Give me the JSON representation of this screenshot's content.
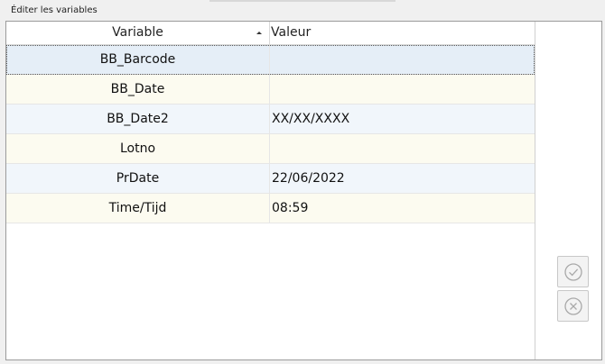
{
  "window": {
    "title": "Éditer les variables"
  },
  "grid": {
    "columns": {
      "variable": "Variable",
      "value": "Valeur"
    },
    "sort": "ascending",
    "rows": [
      {
        "variable": "BB_Barcode",
        "value": "",
        "selected": true
      },
      {
        "variable": "BB_Date",
        "value": ""
      },
      {
        "variable": "BB_Date2",
        "value": "XX/XX/XXXX"
      },
      {
        "variable": "Lotno",
        "value": ""
      },
      {
        "variable": "PrDate",
        "value": "22/06/2022"
      },
      {
        "variable": "Time/Tijd",
        "value": "08:59"
      }
    ]
  },
  "buttons": {
    "ok_icon": "check-circle-icon",
    "cancel_icon": "x-circle-icon"
  }
}
